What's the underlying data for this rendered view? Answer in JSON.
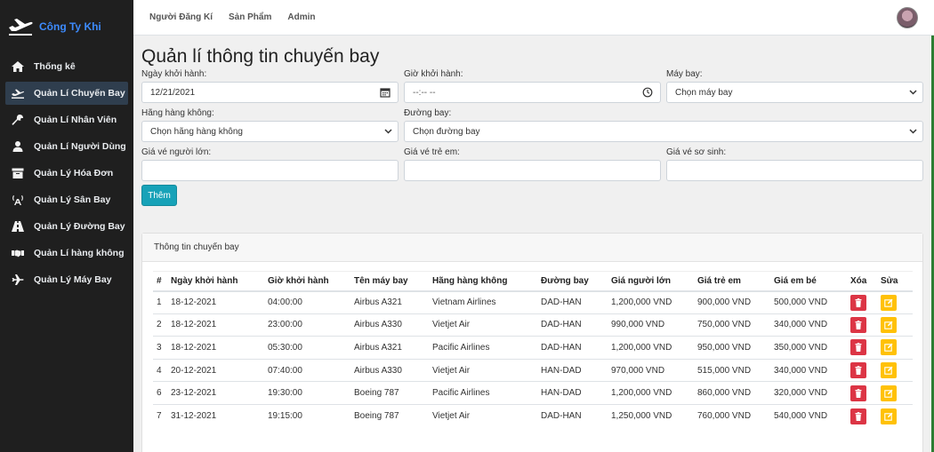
{
  "brand": {
    "name": "Công Ty Khi",
    "icon": "airplane-logo-icon",
    "color": "#3d8bfd"
  },
  "sidebar": {
    "items": [
      {
        "label": "Thống kê",
        "icon": "home-icon",
        "active": false
      },
      {
        "label": "Quản Lí Chuyến Bay",
        "icon": "plane-departure-icon",
        "active": true
      },
      {
        "label": "Quản Lí Nhân Viên",
        "icon": "wrench-icon",
        "active": false
      },
      {
        "label": "Quản Lí Người Dùng",
        "icon": "user-icon",
        "active": false
      },
      {
        "label": "Quản Lý Hóa Đơn",
        "icon": "archive-icon",
        "active": false
      },
      {
        "label": "Quản Lý Sân Bay",
        "icon": "broadcast-tower-icon",
        "active": false
      },
      {
        "label": "Quản Lý Đường Bay",
        "icon": "road-icon",
        "active": false
      },
      {
        "label": "Quản Lí hàng không",
        "icon": "handshake-icon",
        "active": false
      },
      {
        "label": "Quản Lý Máy Bay",
        "icon": "plane-icon",
        "active": false
      }
    ]
  },
  "topbar": {
    "links": [
      "Người Đăng Kí",
      "Sản Phẩm",
      "Admin"
    ],
    "avatar": "user-avatar"
  },
  "page": {
    "title": "Quản lí thông tin chuyến bay"
  },
  "form": {
    "departure_date": {
      "label": "Ngày khởi hành:",
      "value": "12/21/2021"
    },
    "departure_time": {
      "label": "Giờ khởi hành:",
      "value": "--:-- --"
    },
    "aircraft": {
      "label": "Máy bay:",
      "value": "Chọn máy bay"
    },
    "airline": {
      "label": "Hãng hàng không:",
      "value": "Chọn hãng hàng không"
    },
    "route": {
      "label": "Đường bay:",
      "value": "Chọn đường bay"
    },
    "adult_price": {
      "label": "Giá vé người lớn:",
      "value": ""
    },
    "child_price": {
      "label": "Giá vé trẻ em:",
      "value": ""
    },
    "infant_price": {
      "label": "Giá vé sơ sinh:",
      "value": ""
    },
    "add_button": "Thêm"
  },
  "card": {
    "title": "Thông tin chuyến bay",
    "columns": [
      "#",
      "Ngày khởi hành",
      "Giờ khởi hành",
      "Tên máy bay",
      "Hãng hàng không",
      "Đường bay",
      "Giá người lớn",
      "Giá trẻ em",
      "Giá em bé",
      "Xóa",
      "Sửa"
    ],
    "rows": [
      {
        "id": "1",
        "date": "18-12-2021",
        "time": "04:00:00",
        "aircraft": "Airbus A321",
        "airline": "Vietnam Airlines",
        "route": "DAD-HAN",
        "adult": "1,200,000 VND",
        "child": "900,000 VND",
        "infant": "500,000 VND"
      },
      {
        "id": "2",
        "date": "18-12-2021",
        "time": "23:00:00",
        "aircraft": "Airbus A330",
        "airline": "Vietjet Air",
        "route": "DAD-HAN",
        "adult": "990,000 VND",
        "child": "750,000 VND",
        "infant": "340,000 VND"
      },
      {
        "id": "3",
        "date": "18-12-2021",
        "time": "05:30:00",
        "aircraft": "Airbus A321",
        "airline": "Pacific Airlines",
        "route": "DAD-HAN",
        "adult": "1,200,000 VND",
        "child": "950,000 VND",
        "infant": "350,000 VND"
      },
      {
        "id": "4",
        "date": "20-12-2021",
        "time": "07:40:00",
        "aircraft": "Airbus A330",
        "airline": "Vietjet Air",
        "route": "HAN-DAD",
        "adult": "970,000 VND",
        "child": "515,000 VND",
        "infant": "340,000 VND"
      },
      {
        "id": "6",
        "date": "23-12-2021",
        "time": "19:30:00",
        "aircraft": "Boeing 787",
        "airline": "Pacific Airlines",
        "route": "HAN-DAD",
        "adult": "1,200,000 VND",
        "child": "860,000 VND",
        "infant": "320,000 VND"
      },
      {
        "id": "7",
        "date": "31-12-2021",
        "time": "19:15:00",
        "aircraft": "Boeing 787",
        "airline": "Vietjet Air",
        "route": "DAD-HAN",
        "adult": "1,250,000 VND",
        "child": "760,000 VND",
        "infant": "540,000 VND"
      }
    ]
  },
  "colors": {
    "sidebar_bg": "#1f1f1f",
    "active_bg": "#2f3e4e",
    "add_button": "#17a2b8",
    "delete": "#dc3545",
    "edit": "#ffc107"
  }
}
